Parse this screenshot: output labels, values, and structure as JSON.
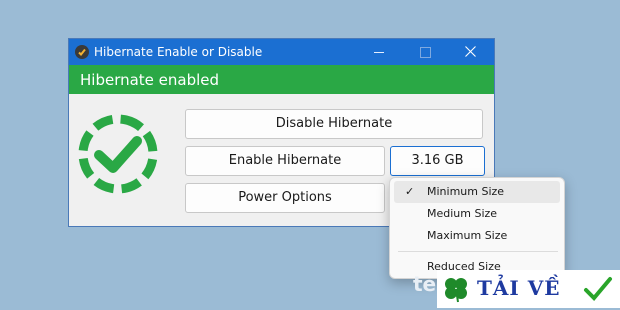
{
  "window": {
    "title": "Hibernate Enable or Disable",
    "status_text": "Hibernate enabled"
  },
  "buttons": {
    "disable": "Disable Hibernate",
    "enable": "Enable Hibernate",
    "power": "Power Options",
    "size": "3.16 GB"
  },
  "menu": {
    "items": [
      {
        "label": "Minimum Size",
        "checked": true
      },
      {
        "label": "Medium Size",
        "checked": false
      },
      {
        "label": "Maximum Size",
        "checked": false
      },
      {
        "label": "Reduced Size",
        "checked": false
      }
    ],
    "check_glyph": "✓"
  },
  "watermark": {
    "logo_text": "TẢI VỀ",
    "partial_text": "te"
  },
  "icons": {
    "app": "hibernate-app-icon",
    "status": "check-circle-icon",
    "leaf": "clover-icon",
    "check": "green-check-icon"
  },
  "colors": {
    "titlebar": "#1b6fd2",
    "status_bar": "#2aa845",
    "status_icon": "#2aa845",
    "logo_text": "#1e3aa0"
  }
}
